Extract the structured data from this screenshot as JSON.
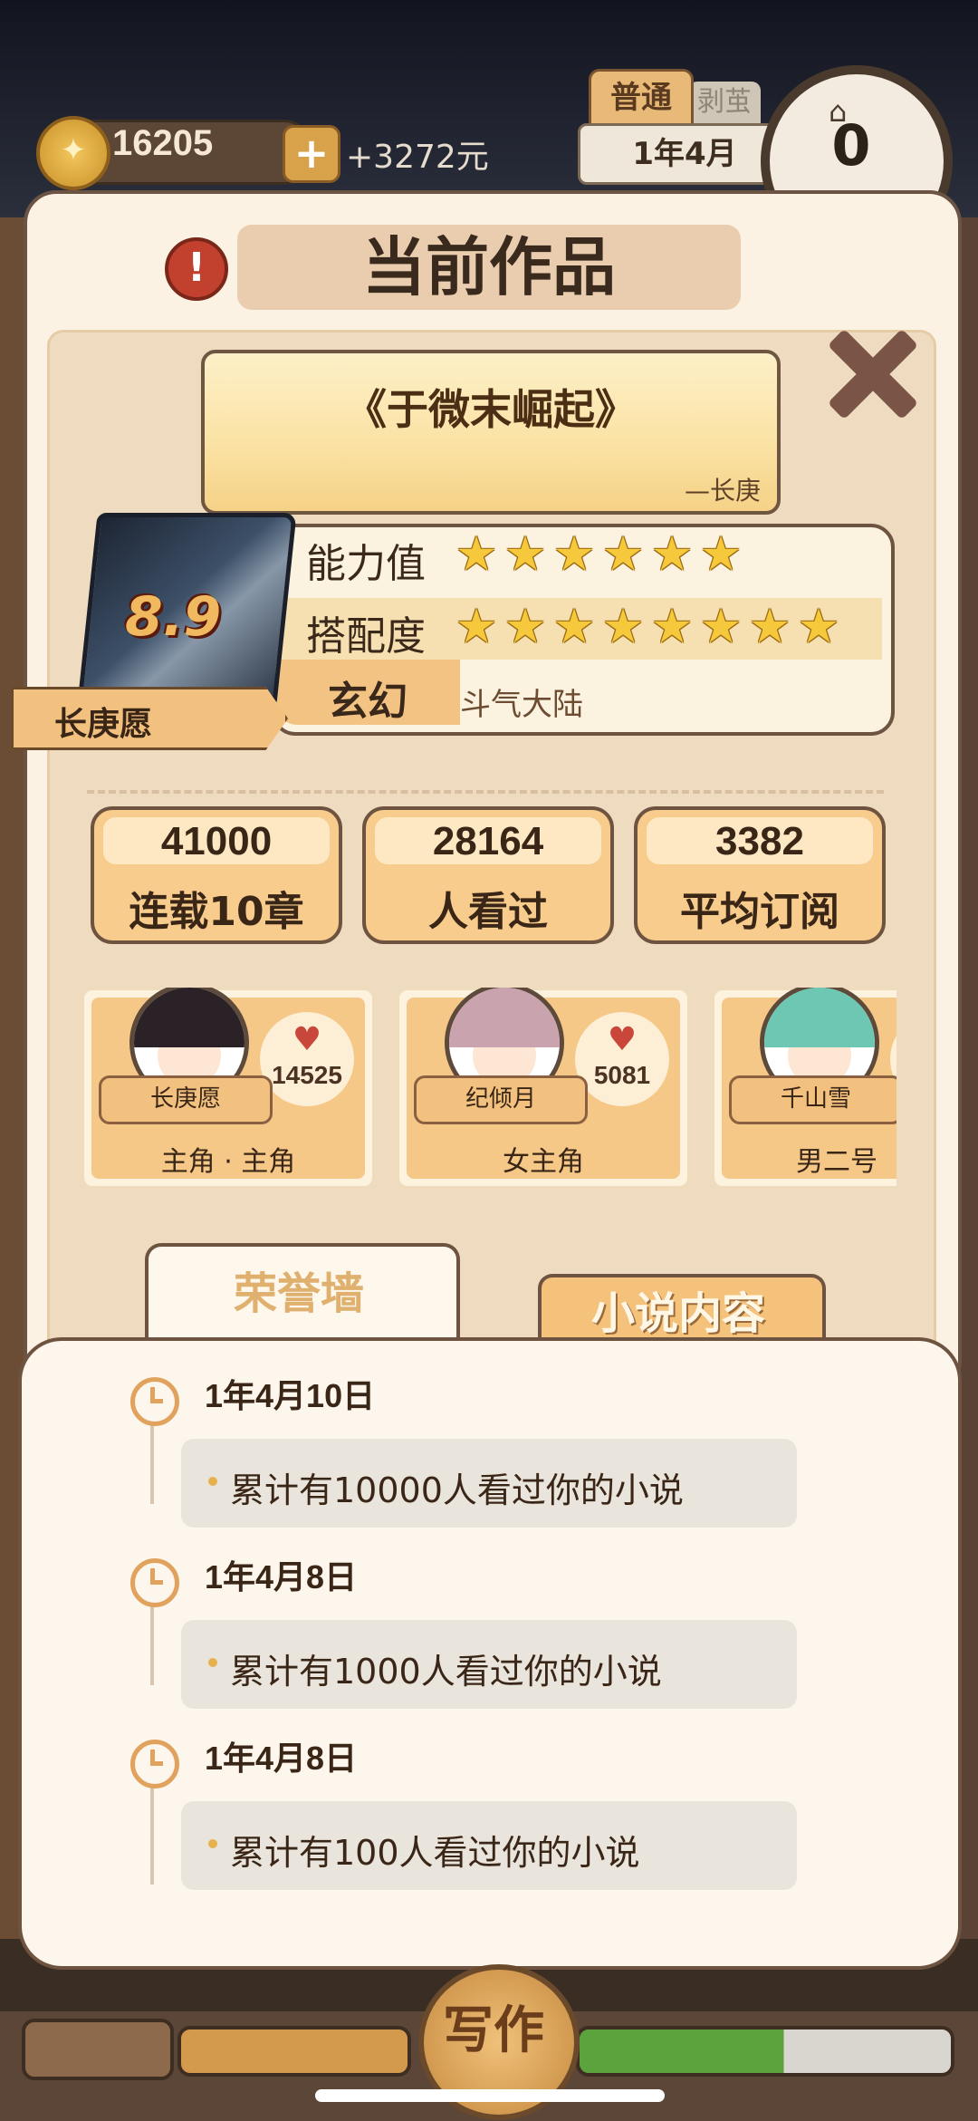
{
  "topbar": {
    "coins": "16205",
    "money_rate": "+3272元",
    "mode": "普通",
    "mode_secondary": "剥茧",
    "date": "1年4月",
    "counter": "0"
  },
  "panel": {
    "title": "当前作品",
    "novel_title": "《于微末崛起》",
    "novel_author": "—长庚",
    "book_score": "8.9",
    "protagonist": "长庚愿",
    "ability_label": "能力值",
    "ability_stars": 6,
    "match_label": "搭配度",
    "match_stars": 8,
    "genre": "玄幻",
    "subgenre": "斗气大陆"
  },
  "stats": [
    {
      "value": "41000",
      "label": "连载10章"
    },
    {
      "value": "28164",
      "label": "人看过"
    },
    {
      "value": "3382",
      "label": "平均订阅"
    }
  ],
  "characters": [
    {
      "name": "长庚愿",
      "likes": "14525",
      "role": "主角 · 主角"
    },
    {
      "name": "纪倾月",
      "likes": "5081",
      "role": "女主角"
    },
    {
      "name": "千山雪",
      "likes": "",
      "role": "男二号"
    }
  ],
  "tabs": {
    "honor": "荣誉墙",
    "content": "小说内容"
  },
  "timeline": [
    {
      "date": "1年4月10日",
      "text": "累计有10000人看过你的小说"
    },
    {
      "date": "1年4月8日",
      "text": "累计有1000人看过你的小说"
    },
    {
      "date": "1年4月8日",
      "text": "累计有100人看过你的小说"
    }
  ],
  "bottom": {
    "write": "写作"
  },
  "icons": {
    "coin": "coin-icon",
    "plus": "plus-icon",
    "alert": "alert-icon",
    "close": "close-icon",
    "heart": "heart-icon",
    "clock": "clock-icon",
    "star": "star-icon"
  },
  "colors": {
    "accent": "#f2c07f",
    "panel_bg": "#fbf2e4",
    "text": "#3a2616",
    "heart": "#c9473a"
  }
}
